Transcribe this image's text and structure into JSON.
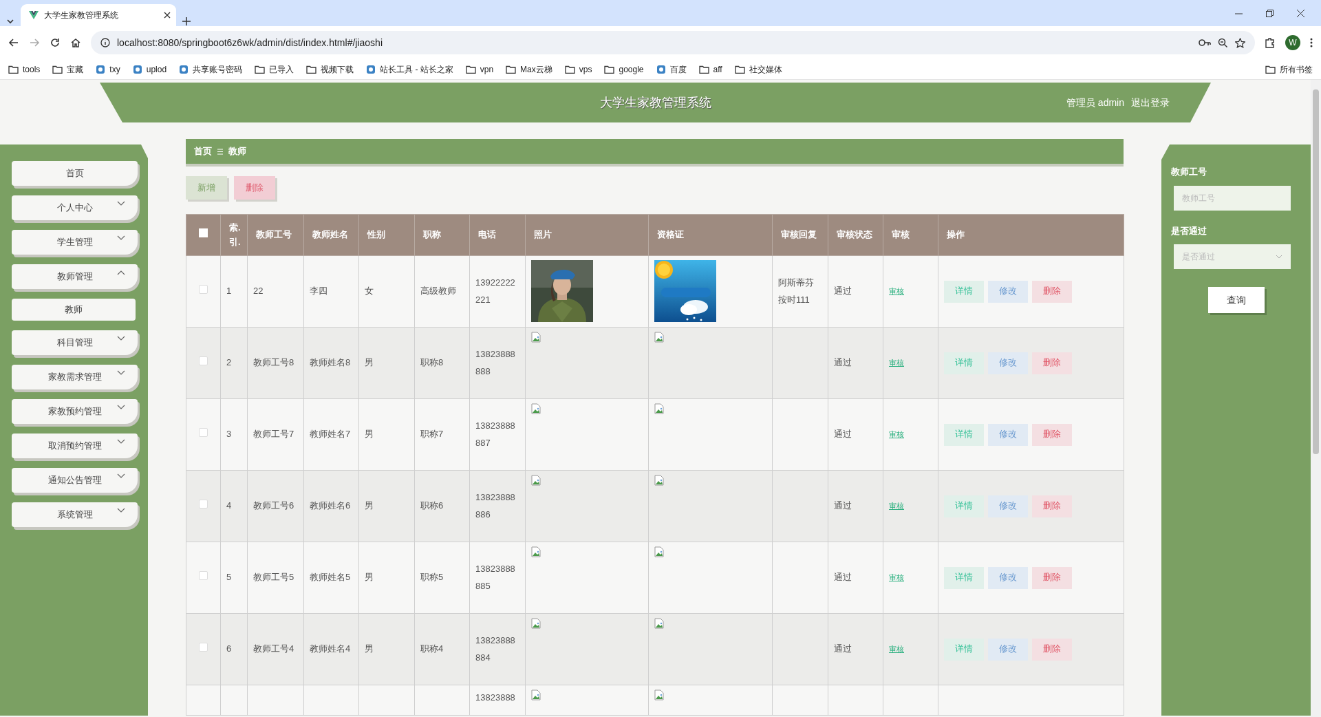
{
  "browser": {
    "tab": {
      "title": "大学生家教管理系统"
    },
    "url": "localhost:8080/springboot6z6wk/admin/dist/index.html#/jiaoshi",
    "profile": "W",
    "bookmarks": [
      {
        "label": "tools",
        "kind": "folder"
      },
      {
        "label": "宝藏",
        "kind": "folder"
      },
      {
        "label": "txy",
        "kind": "site"
      },
      {
        "label": "uplod",
        "kind": "site"
      },
      {
        "label": "共享账号密码",
        "kind": "site"
      },
      {
        "label": "已导入",
        "kind": "folder"
      },
      {
        "label": "视频下载",
        "kind": "folder"
      },
      {
        "label": "站长工具 - 站长之家",
        "kind": "site"
      },
      {
        "label": "vpn",
        "kind": "folder"
      },
      {
        "label": "Max云梯",
        "kind": "folder"
      },
      {
        "label": "vps",
        "kind": "folder"
      },
      {
        "label": "google",
        "kind": "folder"
      },
      {
        "label": "百度",
        "kind": "site"
      },
      {
        "label": "aff",
        "kind": "folder"
      },
      {
        "label": "社交媒体",
        "kind": "folder"
      }
    ],
    "all_bookmarks": "所有书签"
  },
  "header": {
    "title": "大学生家教管理系统",
    "user": "管理员 admin",
    "logout": "退出登录"
  },
  "sidebar": {
    "items": [
      {
        "label": "首页",
        "kind": "link"
      },
      {
        "label": "个人中心",
        "kind": "group",
        "expanded": false
      },
      {
        "label": "学生管理",
        "kind": "group",
        "expanded": false
      },
      {
        "label": "教师管理",
        "kind": "group",
        "expanded": true,
        "children": [
          {
            "label": "教师"
          }
        ]
      },
      {
        "label": "科目管理",
        "kind": "group",
        "expanded": false
      },
      {
        "label": "家教需求管理",
        "kind": "group",
        "expanded": false
      },
      {
        "label": "家教预约管理",
        "kind": "group",
        "expanded": false
      },
      {
        "label": "取消预约管理",
        "kind": "group",
        "expanded": false
      },
      {
        "label": "通知公告管理",
        "kind": "group",
        "expanded": false
      },
      {
        "label": "系统管理",
        "kind": "group",
        "expanded": false
      }
    ]
  },
  "breadcrumb": [
    "首页",
    "教师"
  ],
  "toolbar": {
    "add": "新增",
    "delete": "删除"
  },
  "table": {
    "all_checked": false,
    "columns": [
      "索.引.",
      "教师工号",
      "教师姓名",
      "性别",
      "职称",
      "电话",
      "照片",
      "资格证",
      "审核回复",
      "审核状态",
      "审核",
      "操作"
    ],
    "rows": [
      {
        "checked": false,
        "index": "1",
        "teacher_no": "22",
        "name": "李四",
        "gender": "女",
        "title": "高级教师",
        "phone": "13922222221",
        "reply": "阿斯蒂芬按时111",
        "status": "通过",
        "review": "审核",
        "actions": [
          "详情",
          "修改",
          "删除"
        ]
      },
      {
        "checked": false,
        "index": "2",
        "teacher_no": "教师工号8",
        "name": "教师姓名8",
        "gender": "男",
        "title": "职称8",
        "phone": "13823888888",
        "photo": {
          "kind": "broken"
        },
        "certificate": {
          "kind": "broken"
        },
        "status": "通过",
        "review": "审核",
        "actions": [
          "详情",
          "修改",
          "删除"
        ]
      },
      {
        "checked": false,
        "index": "3",
        "teacher_no": "教师工号7",
        "name": "教师姓名7",
        "gender": "男",
        "title": "职称7",
        "phone": "13823888887",
        "photo": {
          "kind": "broken"
        },
        "certificate": {
          "kind": "broken"
        },
        "status": "通过",
        "review": "审核",
        "actions": [
          "详情",
          "修改",
          "删除"
        ]
      },
      {
        "checked": false,
        "index": "4",
        "teacher_no": "教师工号6",
        "name": "教师姓名6",
        "gender": "男",
        "title": "职称6",
        "phone": "13823888886",
        "photo": {
          "kind": "broken"
        },
        "certificate": {
          "kind": "broken"
        },
        "status": "通过",
        "review": "审核",
        "actions": [
          "详情",
          "修改",
          "删除"
        ]
      },
      {
        "checked": false,
        "index": "5",
        "teacher_no": "教师工号5",
        "name": "教师姓名5",
        "gender": "男",
        "title": "职称5",
        "phone": "13823888885",
        "photo": {
          "kind": "broken"
        },
        "certificate": {
          "kind": "broken"
        },
        "status": "通过",
        "review": "审核",
        "actions": [
          "详情",
          "修改",
          "删除"
        ]
      },
      {
        "checked": false,
        "index": "6",
        "teacher_no": "教师工号4",
        "name": "教师姓名4",
        "gender": "男",
        "title": "职称4",
        "phone": "13823888884",
        "photo": {
          "kind": "broken"
        },
        "certificate": {
          "kind": "broken"
        },
        "status": "通过",
        "review": "审核",
        "actions": [
          "详情",
          "修改",
          "删除"
        ]
      },
      {
        "phone": "13823888",
        "photo": {
          "kind": "broken"
        },
        "certificate": {
          "kind": "broken"
        }
      }
    ]
  },
  "search": {
    "fields": [
      {
        "label": "教师工号",
        "kind": "input",
        "placeholder": "教师工号"
      },
      {
        "label": "是否通过",
        "kind": "select",
        "placeholder": "是否通过"
      }
    ],
    "button": "查询"
  }
}
